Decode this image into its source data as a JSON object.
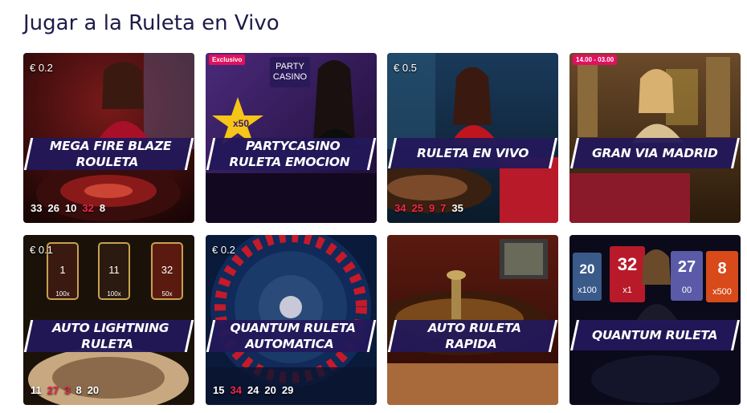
{
  "page": {
    "title": "Jugar a la Ruleta en Vivo"
  },
  "colors": {
    "banner": "#23185a",
    "red_number": "#f0284a",
    "badge": "#e0115f",
    "title": "#1e1b4b"
  },
  "games": [
    {
      "name_lines": [
        "MEGA FIRE BLAZE",
        "ROULETA"
      ],
      "stake": "€ 0.2",
      "badge": "",
      "results": [
        {
          "n": "33",
          "c": "white"
        },
        {
          "n": "26",
          "c": "white"
        },
        {
          "n": "10",
          "c": "white"
        },
        {
          "n": "32",
          "c": "red"
        },
        {
          "n": "8",
          "c": "white"
        }
      ]
    },
    {
      "name_lines": [
        "PARTYCASINO",
        "RULETA EMOCION"
      ],
      "stake": "",
      "badge": "Exclusivo",
      "logo_text": [
        "PARTY",
        "CASINO"
      ],
      "multiplier": "x50",
      "results": []
    },
    {
      "name_lines": [
        "RULETA EN VIVO"
      ],
      "stake": "€ 0.5",
      "badge": "",
      "results": [
        {
          "n": "34",
          "c": "red"
        },
        {
          "n": "25",
          "c": "red"
        },
        {
          "n": "9",
          "c": "red"
        },
        {
          "n": "7",
          "c": "red"
        },
        {
          "n": "35",
          "c": "white"
        }
      ]
    },
    {
      "name_lines": [
        "GRAN VIA MADRID"
      ],
      "stake": "",
      "badge": "14.00 - 03.00",
      "results": []
    },
    {
      "name_lines": [
        "AUTO LIGHTNING",
        "RULETA"
      ],
      "stake": "€ 0.1",
      "badge": "",
      "lanterns": [
        {
          "num": "1",
          "mult": "100x"
        },
        {
          "num": "11",
          "mult": "100x"
        },
        {
          "num": "32",
          "mult": "50x"
        }
      ],
      "results": [
        {
          "n": "11",
          "c": "white"
        },
        {
          "n": "27",
          "c": "red"
        },
        {
          "n": "3",
          "c": "red"
        },
        {
          "n": "8",
          "c": "white"
        },
        {
          "n": "20",
          "c": "white"
        }
      ]
    },
    {
      "name_lines": [
        "QUANTUM RULETA",
        "AUTOMATICA"
      ],
      "stake": "€ 0.2",
      "badge": "",
      "results": [
        {
          "n": "15",
          "c": "white"
        },
        {
          "n": "34",
          "c": "red"
        },
        {
          "n": "24",
          "c": "white"
        },
        {
          "n": "20",
          "c": "white"
        },
        {
          "n": "29",
          "c": "white"
        }
      ]
    },
    {
      "name_lines": [
        "AUTO RULETA",
        "RAPIDA"
      ],
      "stake": "",
      "badge": "",
      "results": []
    },
    {
      "name_lines": [
        "QUANTUM RULETA"
      ],
      "stake": "",
      "badge": "",
      "tiles": [
        {
          "num": "20",
          "mult": "x100"
        },
        {
          "num": "32",
          "mult": "x1"
        },
        {
          "num": "27",
          "mult": "00"
        },
        {
          "num": "8",
          "mult": "x500"
        }
      ],
      "results": []
    }
  ]
}
